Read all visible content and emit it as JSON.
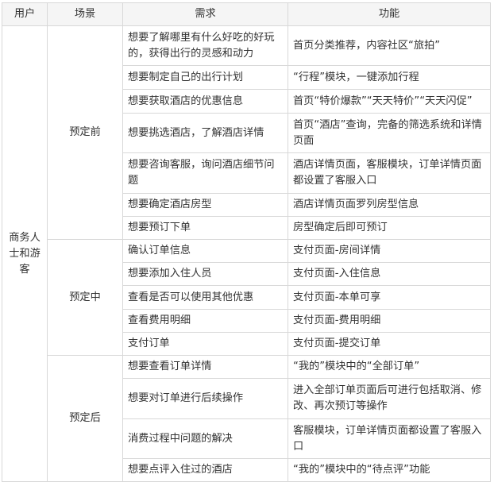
{
  "headers": [
    "用户",
    "场景",
    "需求",
    "功能"
  ],
  "user": "商务人士和游客",
  "groups": [
    {
      "scene": "预定前",
      "rows": [
        {
          "need": "想要了解哪里有什么好吃的好玩的，获得出行的灵感和动力",
          "feature": "首页分类推荐，内容社区“旅拍”"
        },
        {
          "need": "想要制定自己的出行计划",
          "feature": "“行程”模块，一键添加行程"
        },
        {
          "need": "想要获取酒店的优惠信息",
          "feature": "首页“特价爆款”“天天特价”“天天闪促”"
        },
        {
          "need": "想要挑选酒店，了解酒店详情",
          "feature": "首页“酒店”查询，完备的筛选系统和详情页面"
        },
        {
          "need": "想要咨询客服，询问酒店细节问题",
          "feature": "酒店详情页面，客服模块，订单详情页面都设置了客服入口"
        },
        {
          "need": "想要确定酒店房型",
          "feature": "酒店详情页面罗列房型信息"
        },
        {
          "need": "想要预订下单",
          "feature": "房型确定后即可预订"
        }
      ]
    },
    {
      "scene": "预定中",
      "rows": [
        {
          "need": "确认订单信息",
          "feature": "支付页面-房间详情"
        },
        {
          "need": "想要添加入住人员",
          "feature": "支付页面-入住信息"
        },
        {
          "need": "查看是否可以使用其他优惠",
          "feature": "支付页面-本单可享"
        },
        {
          "need": "查看费用明细",
          "feature": "支付页面-费用明细"
        },
        {
          "need": "支付订单",
          "feature": "支付页面-提交订单"
        }
      ]
    },
    {
      "scene": "预定后",
      "rows": [
        {
          "need": "想要查看订单详情",
          "feature": "“我的”模块中的“全部订单”"
        },
        {
          "need": "想要对订单进行后续操作",
          "feature": "进入全部订单页面后可进行包括取消、修改、再次预订等操作"
        },
        {
          "need": "消费过程中问题的解决",
          "feature": "客服模块，订单详情页面都设置了客服入口"
        },
        {
          "need": "想要点评入住过的酒店",
          "feature": "“我的”模块中的“待点评”功能"
        }
      ]
    }
  ]
}
